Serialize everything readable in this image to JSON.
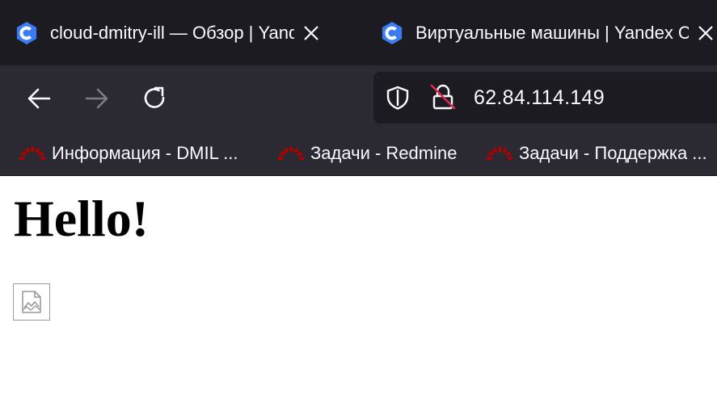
{
  "tabs": [
    {
      "title": "cloud-dmitry-ill — Обзор | Yandex",
      "favicon": "yandex-cloud-icon"
    },
    {
      "title": "Виртуальные машины | Yandex Cloud",
      "favicon": "yandex-cloud-icon"
    }
  ],
  "navbar": {
    "url": "62.84.114.149",
    "icons": [
      "back-arrow-icon",
      "forward-arrow-icon",
      "reload-icon",
      "shield-icon",
      "insecure-lock-icon"
    ]
  },
  "bookmarks": [
    {
      "label": "Информация - DMIL ...",
      "icon": "redmine-icon"
    },
    {
      "label": "Задачи - Redmine",
      "icon": "redmine-icon"
    },
    {
      "label": "Задачи - Поддержка ...",
      "icon": "redmine-icon"
    }
  ],
  "page": {
    "heading": "Hello!",
    "image": "broken-image-icon"
  },
  "colors": {
    "tabbar_bg": "#1c1b22",
    "toolbar_bg": "#2b2a33",
    "yandex_cloud_blue": "#3b7cf4",
    "redmine_red": "#b00000",
    "insecure_slash": "#e22850"
  }
}
